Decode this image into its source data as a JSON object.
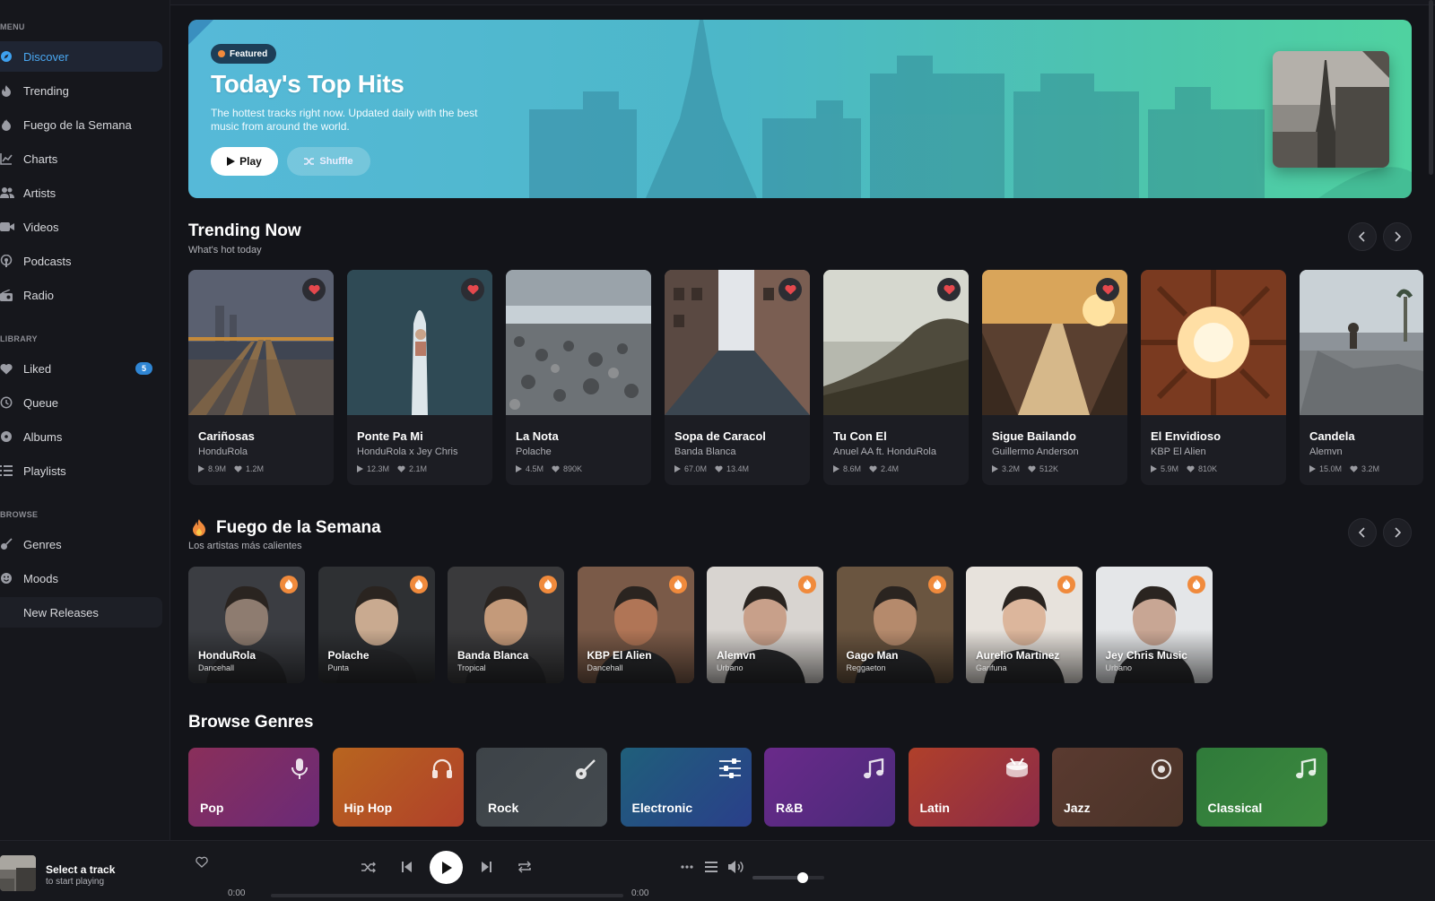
{
  "sidebar": {
    "menu_label": "MENU",
    "library_label": "LIBRARY",
    "browse_label": "BROWSE",
    "menu": [
      {
        "label": "Discover",
        "icon": "compass-icon"
      },
      {
        "label": "Trending",
        "icon": "flame-icon"
      },
      {
        "label": "Fuego de la Semana",
        "icon": "fire-icon"
      },
      {
        "label": "Charts",
        "icon": "chart-line-icon"
      },
      {
        "label": "Artists",
        "icon": "users-icon"
      },
      {
        "label": "Videos",
        "icon": "video-icon"
      },
      {
        "label": "Podcasts",
        "icon": "podcast-icon"
      },
      {
        "label": "Radio",
        "icon": "radio-icon"
      }
    ],
    "library": [
      {
        "label": "Liked",
        "icon": "heart-icon",
        "badge": "5"
      },
      {
        "label": "Queue",
        "icon": "history-icon"
      },
      {
        "label": "Albums",
        "icon": "disc-icon"
      },
      {
        "label": "Playlists",
        "icon": "list-icon"
      }
    ],
    "browse": [
      {
        "label": "Genres",
        "icon": "guitar-icon"
      },
      {
        "label": "Moods",
        "icon": "smile-icon"
      },
      {
        "label": "New Releases",
        "icon": ""
      }
    ]
  },
  "hero": {
    "badge": "Featured",
    "title": "Today's Top Hits",
    "description": "The hottest tracks right now. Updated daily with the best music from around the world.",
    "play_label": "Play",
    "shuffle_label": "Shuffle"
  },
  "trending": {
    "title": "Trending Now",
    "subtitle": "What's hot today",
    "cards": [
      {
        "title": "Cariñosas",
        "artist": "HonduRola",
        "plays": "8.9M",
        "likes": "1.2M",
        "liked": true
      },
      {
        "title": "Ponte Pa Mi",
        "artist": "HonduRola x Jey Chris",
        "plays": "12.3M",
        "likes": "2.1M",
        "liked": true
      },
      {
        "title": "La Nota",
        "artist": "Polache",
        "plays": "4.5M",
        "likes": "890K",
        "liked": false
      },
      {
        "title": "Sopa de Caracol",
        "artist": "Banda Blanca",
        "plays": "67.0M",
        "likes": "13.4M",
        "liked": true
      },
      {
        "title": "Tu Con El",
        "artist": "Anuel AA ft. HonduRola",
        "plays": "8.6M",
        "likes": "2.4M",
        "liked": true
      },
      {
        "title": "Sigue Bailando",
        "artist": "Guillermo Anderson",
        "plays": "3.2M",
        "likes": "512K",
        "liked": true
      },
      {
        "title": "El Envidioso",
        "artist": "KBP El Alien",
        "plays": "5.9M",
        "likes": "810K",
        "liked": false
      },
      {
        "title": "Candela",
        "artist": "Alemvn",
        "plays": "15.0M",
        "likes": "3.2M",
        "liked": false
      }
    ]
  },
  "fuego": {
    "title": "Fuego de la Semana",
    "subtitle": "Los artistas más calientes",
    "artists": [
      {
        "name": "HonduRola",
        "genre": "Dancehall"
      },
      {
        "name": "Polache",
        "genre": "Punta"
      },
      {
        "name": "Banda Blanca",
        "genre": "Tropical"
      },
      {
        "name": "KBP El Alien",
        "genre": "Dancehall"
      },
      {
        "name": "Alemvn",
        "genre": "Urbano"
      },
      {
        "name": "Gago Man",
        "genre": "Reggaeton"
      },
      {
        "name": "Aurelio Martinez",
        "genre": "Garifuna"
      },
      {
        "name": "Jey Chris Music",
        "genre": "Urbano"
      }
    ]
  },
  "genres": {
    "title": "Browse Genres",
    "items": [
      {
        "label": "Pop",
        "icon": "microphone-icon"
      },
      {
        "label": "Hip Hop",
        "icon": "headphones-icon"
      },
      {
        "label": "Rock",
        "icon": "guitar-icon"
      },
      {
        "label": "Electronic",
        "icon": "sliders-icon"
      },
      {
        "label": "R&B",
        "icon": "music-note-icon"
      },
      {
        "label": "Latin",
        "icon": "drum-icon"
      },
      {
        "label": "Jazz",
        "icon": "record-icon"
      },
      {
        "label": "Classical",
        "icon": "music-note-icon"
      }
    ]
  },
  "player": {
    "title": "Select a track",
    "subtitle": "to start playing",
    "elapsed": "0:00",
    "duration": "0:00",
    "progress": 0,
    "volume": 0.7
  },
  "colors": {
    "accent": "#3ea1f0",
    "background": "#131419",
    "fire": "#f08a3c",
    "heart": "#e5484d"
  }
}
